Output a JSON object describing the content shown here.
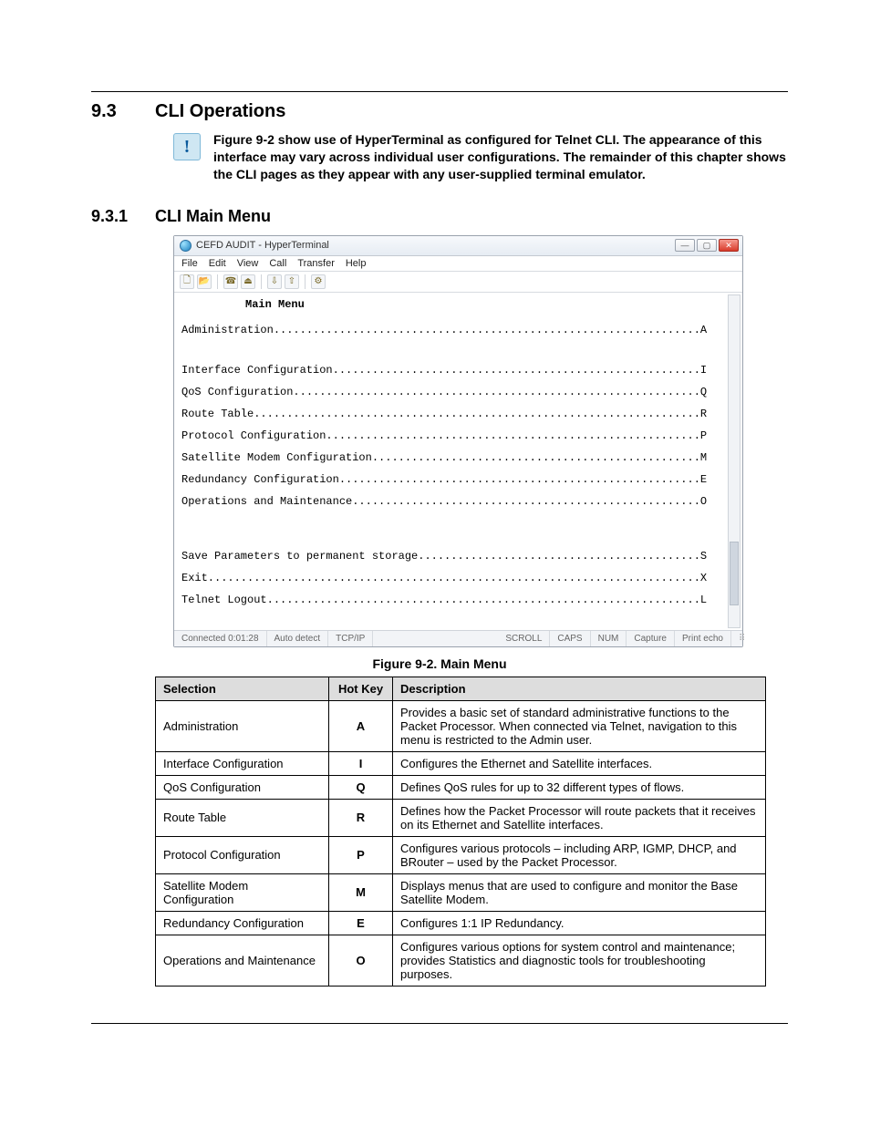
{
  "headings": {
    "sec1_num": "9.3",
    "sec1_txt": "CLI Operations",
    "sec2_num": "9.3.1",
    "sec2_txt": "CLI Main Menu"
  },
  "note": {
    "icon_glyph": "!",
    "text": "Figure 9-2 show use of HyperTerminal as configured for Telnet CLI. The appearance of this interface may vary across individual user configurations. The remainder of this chapter shows the CLI pages as they appear with any user-supplied terminal emulator."
  },
  "hyperterm": {
    "title": "CEFD AUDIT - HyperTerminal",
    "menu": [
      "File",
      "Edit",
      "View",
      "Call",
      "Transfer",
      "Help"
    ],
    "term_title": "Main Menu",
    "lines": [
      {
        "label": "Administration",
        "key": "A",
        "gap_after": true
      },
      {
        "label": "Interface Configuration",
        "key": "I"
      },
      {
        "label": "QoS Configuration",
        "key": "Q"
      },
      {
        "label": "Route Table",
        "key": "R"
      },
      {
        "label": "Protocol Configuration",
        "key": "P"
      },
      {
        "label": "Satellite Modem Configuration",
        "key": "M"
      },
      {
        "label": "Redundancy Configuration",
        "key": "E"
      },
      {
        "label": "Operations and Maintenance",
        "key": "O",
        "gap_after": true,
        "big_gap": true
      },
      {
        "label": "Save Parameters to permanent storage",
        "key": "S"
      },
      {
        "label": "Exit",
        "key": "X"
      },
      {
        "label": "Telnet Logout",
        "key": "L"
      }
    ],
    "status": {
      "connected": "Connected 0:01:28",
      "detect": "Auto detect",
      "proto": "TCP/IP",
      "scroll": "SCROLL",
      "caps": "CAPS",
      "num": "NUM",
      "capture": "Capture",
      "echo": "Print echo"
    },
    "min_label": "—",
    "max_label": "▢",
    "close_label": "✕"
  },
  "figure_caption": "Figure 9-2. Main Menu",
  "table": {
    "headers": {
      "selection": "Selection",
      "hotkey": "Hot Key",
      "description": "Description"
    },
    "rows": [
      {
        "sel": "Administration",
        "hk": "A",
        "desc": "Provides a basic set of standard administrative functions to the Packet Processor. When connected via Telnet, navigation to this menu is restricted to the Admin user."
      },
      {
        "sel": "Interface Configuration",
        "hk": "I",
        "desc": "Configures the Ethernet and Satellite interfaces."
      },
      {
        "sel": "QoS Configuration",
        "hk": "Q",
        "desc": "Defines QoS rules for up to 32 different types of flows."
      },
      {
        "sel": "Route Table",
        "hk": "R",
        "desc": "Defines how the Packet Processor will route packets that it receives on its Ethernet and Satellite interfaces."
      },
      {
        "sel": "Protocol Configuration",
        "hk": "P",
        "desc": "Configures various protocols – including ARP, IGMP, DHCP, and BRouter – used by the Packet Processor."
      },
      {
        "sel": "Satellite Modem Configuration",
        "hk": "M",
        "desc": "Displays menus that are used to configure and monitor the Base Satellite Modem."
      },
      {
        "sel": "Redundancy Configuration",
        "hk": "E",
        "desc": "Configures 1:1 IP Redundancy."
      },
      {
        "sel": "Operations and Maintenance",
        "hk": "O",
        "desc": "Configures various options for system control and maintenance; provides Statistics and diagnostic tools for troubleshooting purposes."
      }
    ]
  }
}
